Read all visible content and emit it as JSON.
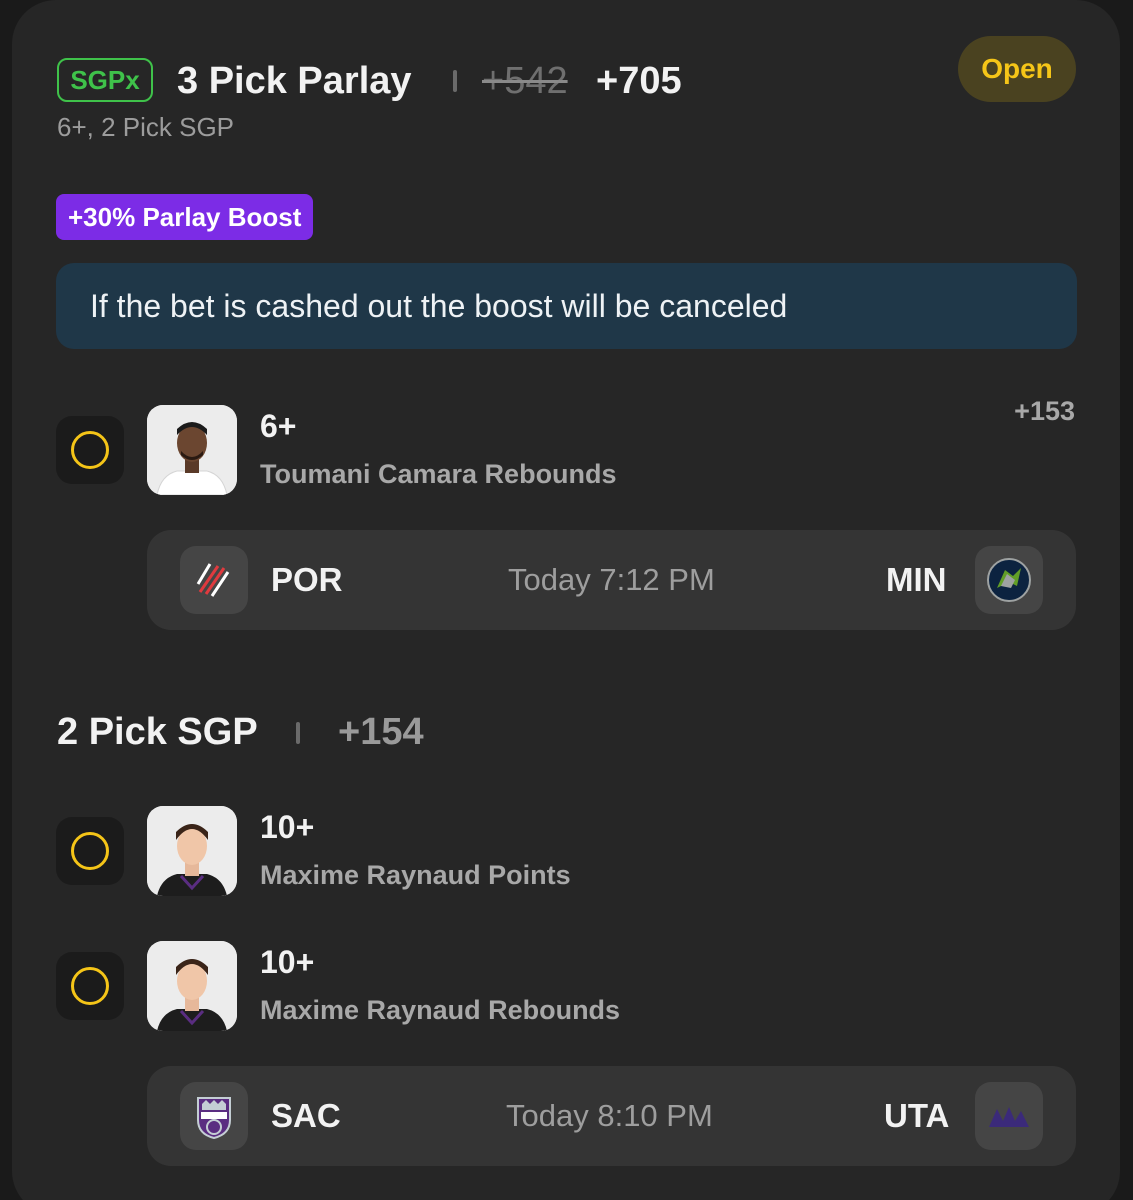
{
  "header": {
    "badge": "SGPx",
    "title": "3 Pick Parlay",
    "odds_original": "+542",
    "odds_boosted": "+705",
    "subtitle": "6+, 2 Pick SGP",
    "status": "Open"
  },
  "boost": {
    "label": "+30% Parlay Boost",
    "notice": "If the bet is cashed out the boost will be canceled"
  },
  "legs": [
    {
      "line": "6+",
      "desc": "Toumani Camara Rebounds",
      "odds": "+153"
    },
    {
      "line": "10+",
      "desc": "Maxime Raynaud Points"
    },
    {
      "line": "10+",
      "desc": "Maxime Raynaud Rebounds"
    }
  ],
  "games": [
    {
      "away": "POR",
      "time": "Today 7:12 PM",
      "home": "MIN"
    },
    {
      "away": "SAC",
      "time": "Today 8:10 PM",
      "home": "UTA"
    }
  ],
  "sgp": {
    "title": "2 Pick SGP",
    "odds": "+154"
  },
  "colors": {
    "accent_yellow": "#f5c518",
    "sgpx_green": "#3fc24a",
    "boost_purple": "#7c2ce6",
    "notice_bg": "#1f3748"
  },
  "icons": [
    "check-circle-icon",
    "player-photo",
    "trail-blazers-logo",
    "timberwolves-logo",
    "kings-logo",
    "jazz-logo"
  ]
}
